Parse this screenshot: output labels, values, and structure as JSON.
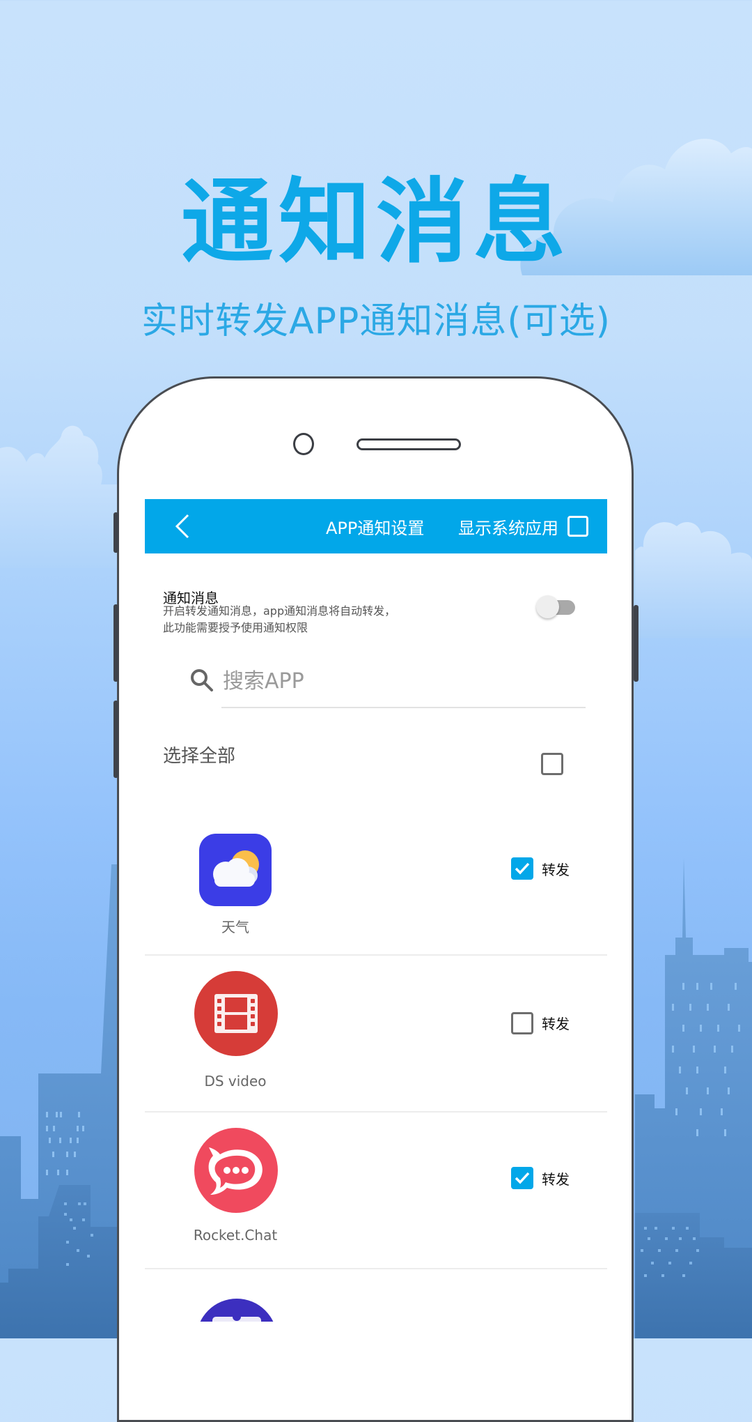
{
  "promo": {
    "headline": "通知消息",
    "subheadline": "实时转发APP通知消息(可选)"
  },
  "colors": {
    "accent": "#02a7e9",
    "headline": "#0ea8e8",
    "subheadline": "#2ba8e5"
  },
  "topbar": {
    "back_icon": "chevron-left-icon",
    "title": "APP通知设置",
    "show_system_label": "显示系统应用",
    "show_system_checked": false
  },
  "notification": {
    "title": "通知消息",
    "description_line1": "开启转发通知消息，app通知消息将自动转发，",
    "description_line2": "此功能需要授予使用通知权限",
    "enabled": false
  },
  "search": {
    "icon": "search-icon",
    "placeholder": "搜索APP",
    "value": ""
  },
  "select_all": {
    "label": "选择全部",
    "checked": false
  },
  "apps": [
    {
      "name": "天气",
      "icon": "weather-icon",
      "forward_label": "转发",
      "forward": true
    },
    {
      "name": "DS video",
      "icon": "film-icon",
      "forward_label": "转发",
      "forward": false
    },
    {
      "name": "Rocket.Chat",
      "icon": "chat-bubble-icon",
      "forward_label": "转发",
      "forward": true
    },
    {
      "name": "",
      "icon": "app-icon-partial",
      "forward_label": "",
      "forward": null
    }
  ]
}
